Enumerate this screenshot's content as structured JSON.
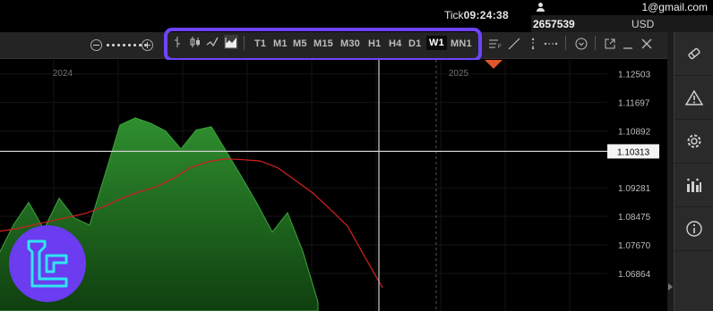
{
  "clock": {
    "prefix": "Tick",
    "time": "09:24:38"
  },
  "account": {
    "email": "1@gmail.com",
    "id": "2657539",
    "currency": "USD"
  },
  "chart_types": [
    "bar-chart-icon",
    "candlestick-icon",
    "line-chart-icon",
    "area-chart-icon"
  ],
  "timeframes": [
    "T1",
    "M1",
    "M5",
    "M15",
    "M30",
    "H1",
    "H4",
    "D1",
    "W1",
    "MN1"
  ],
  "active_timeframe": "W1",
  "chart_data": {
    "type": "area",
    "x_labels": [
      "2024",
      "2025"
    ],
    "price_ticks": [
      "1.12503",
      "1.11697",
      "1.10892",
      "1.10313",
      "1.09281",
      "1.08475",
      "1.07670",
      "1.06864"
    ],
    "crosshair_price": "1.10313",
    "price_series": [
      1.0738,
      1.0823,
      1.0887,
      1.0811,
      1.0899,
      1.0843,
      1.0823,
      1.0964,
      1.1106,
      1.1126,
      1.1111,
      1.1089,
      1.1038,
      1.1092,
      1.1101,
      1.103,
      1.0958,
      1.0884,
      1.0803,
      1.0858,
      1.0749,
      1.0605
    ],
    "moving_average": [
      1.0805,
      1.0812,
      1.0823,
      1.0834,
      1.0845,
      1.0856,
      1.0874,
      1.0897,
      1.0916,
      1.093,
      1.0954,
      1.0985,
      1.1002,
      1.101,
      1.1008,
      1.1004,
      1.0985,
      1.095,
      1.0914,
      1.0868,
      1.082,
      1.0732,
      1.0646
    ],
    "ylim": [
      1.058,
      1.129
    ]
  },
  "colors": {
    "area": "#1e6e1e",
    "ma": "#c82020",
    "accent": "#6e44ff",
    "marker": "#e0552a"
  }
}
